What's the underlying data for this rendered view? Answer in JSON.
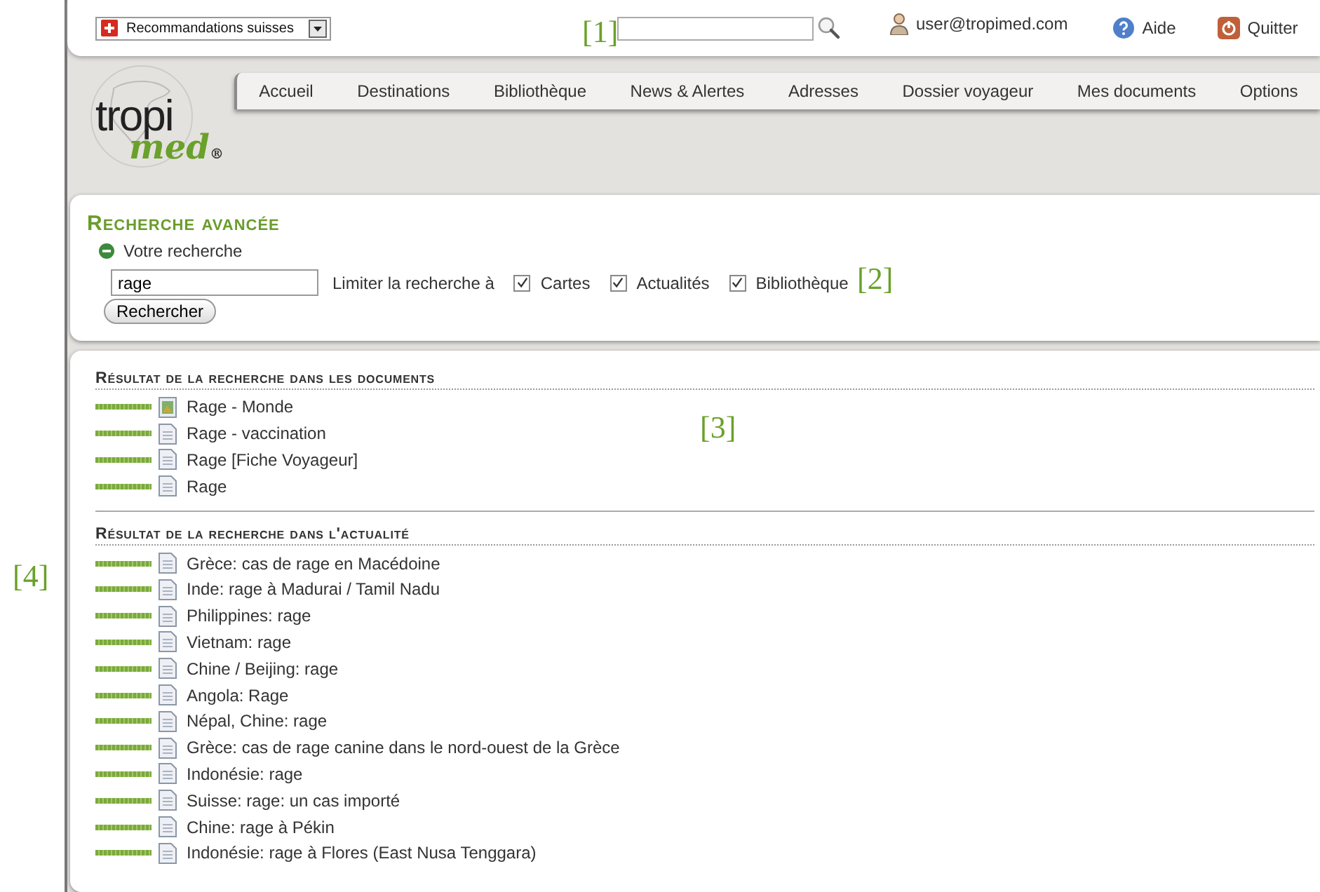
{
  "callouts": [
    {
      "label": "[1]",
      "kind": "search"
    },
    {
      "label": "[2]",
      "kind": "filters"
    },
    {
      "label": "[3]",
      "kind": "results"
    },
    {
      "label": "[4]",
      "kind": "news"
    }
  ],
  "top_bar": {
    "dropdown": {
      "value": "Recommandations suisses"
    },
    "user": "user@tropimed.com",
    "help": "Aide",
    "quit": "Quitter"
  },
  "nav": [
    {
      "label": "Accueil",
      "selected": false
    },
    {
      "label": "Destinations",
      "selected": false
    },
    {
      "label": "Bibliothèque",
      "selected": false
    },
    {
      "label": "News & Alertes",
      "selected": false
    },
    {
      "label": "Adresses",
      "selected": false
    },
    {
      "label": "Dossier voyageur",
      "selected": false
    },
    {
      "label": "Mes documents",
      "selected": false
    },
    {
      "label": "Options",
      "selected": false
    }
  ],
  "logo": {
    "word1": "tropi",
    "word2": "med",
    "mark": "®"
  },
  "advanced_search": {
    "title": "Recherche avancée",
    "toggle": "Votre recherche",
    "expanded": true,
    "query": "rage",
    "limit_label": "Limiter la recherche à",
    "filters": [
      {
        "label": "Cartes",
        "checked": true
      },
      {
        "label": "Actualités",
        "checked": true
      },
      {
        "label": "Bibliothèque",
        "checked": true
      }
    ],
    "button": "Rechercher"
  },
  "sections": [
    {
      "title": "Résultat de la recherche dans les documents",
      "items": [
        {
          "title": "Rage - Monde",
          "kind": "map",
          "level": 1
        },
        {
          "title": "Rage - vaccination",
          "kind": "document",
          "level": 1
        },
        {
          "title": "Rage [Fiche Voyageur]",
          "kind": "document",
          "level": 1
        },
        {
          "title": "Rage",
          "kind": "document",
          "level": 1
        }
      ]
    },
    {
      "title": "Résultat de la recherche dans l'actualité",
      "items": [
        {
          "title": "Grèce: cas de rage en Macédoine",
          "kind": "document",
          "level": 1
        },
        {
          "title": "Inde: rage à Madurai / Tamil Nadu",
          "kind": "document",
          "level": 1
        },
        {
          "title": "Philippines: rage",
          "kind": "document",
          "level": 1
        },
        {
          "title": "Vietnam: rage",
          "kind": "document",
          "level": 1
        },
        {
          "title": "Chine / Beijing: rage",
          "kind": "document",
          "level": 1
        },
        {
          "title": "Angola: Rage",
          "kind": "document",
          "level": 1
        },
        {
          "title": "Népal, Chine: rage",
          "kind": "document",
          "level": 1
        },
        {
          "title": "Grèce: cas de rage canine dans le nord-ouest de la Grèce",
          "kind": "document",
          "level": 1
        },
        {
          "title": "Indonésie: rage",
          "kind": "document",
          "level": 1
        },
        {
          "title": "Suisse: rage: un cas importé",
          "kind": "document",
          "level": 1
        },
        {
          "title": "Chine: rage à Pékin",
          "kind": "document",
          "level": 1
        },
        {
          "title": "Indonésie: rage à Flores (East Nusa Tenggara)",
          "kind": "document",
          "level": 1
        }
      ]
    }
  ]
}
